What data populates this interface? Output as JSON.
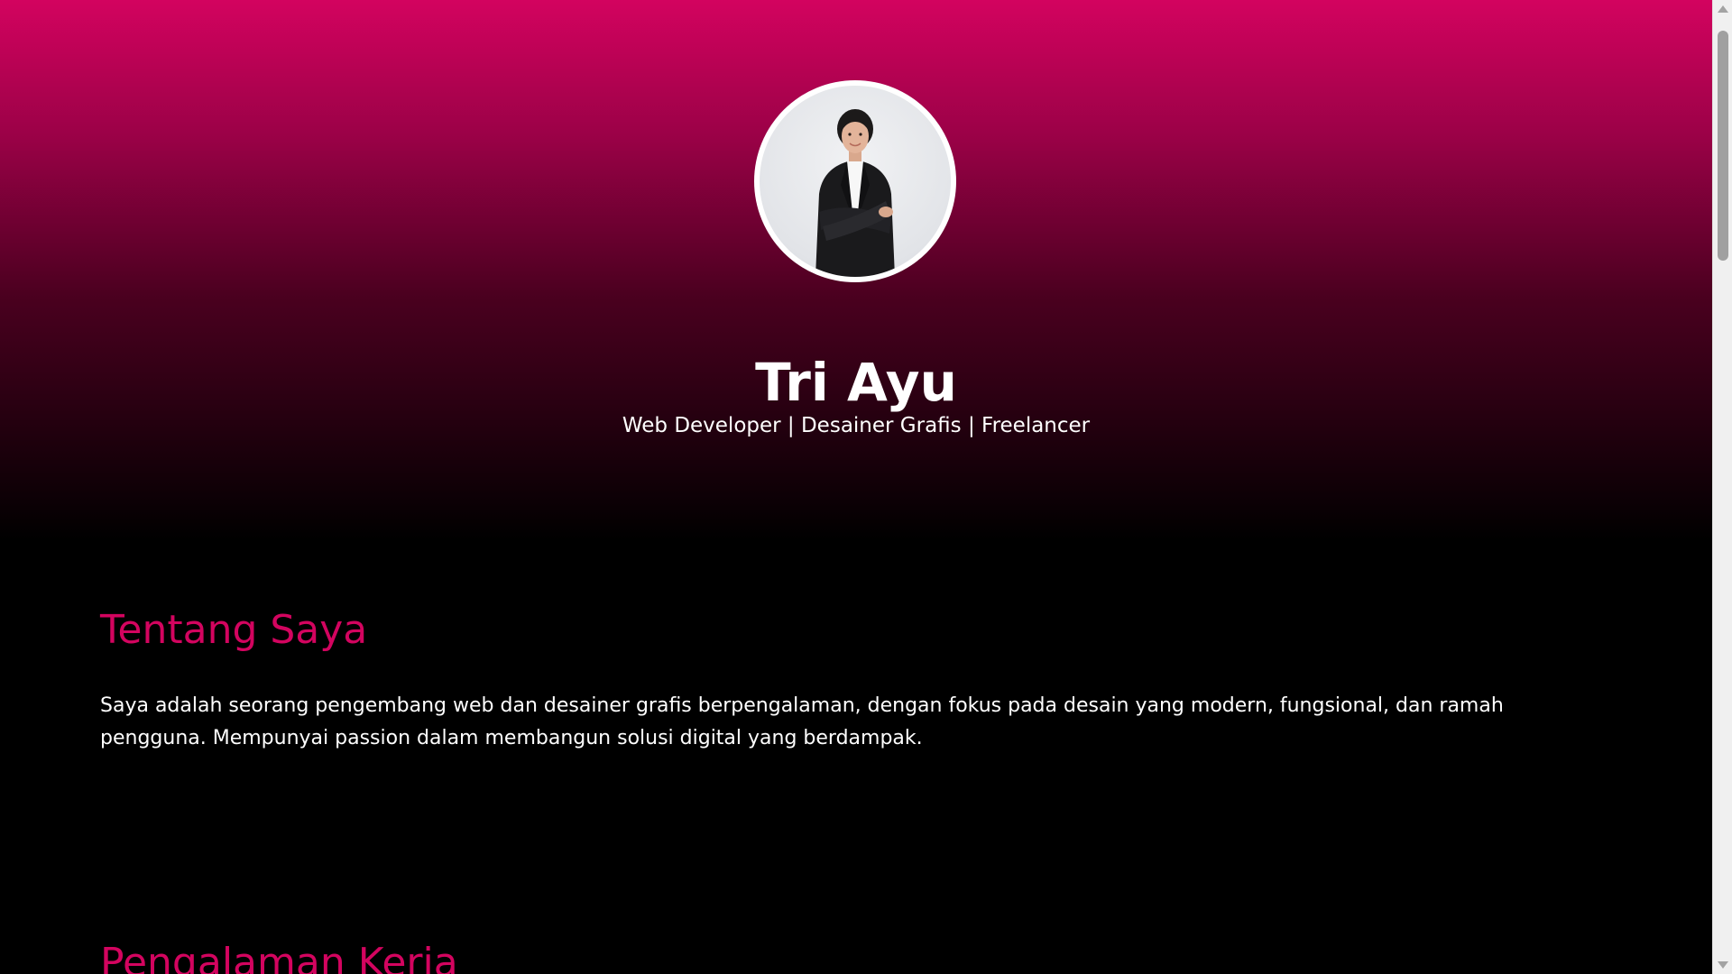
{
  "hero": {
    "name": "Tri Ayu",
    "tagline": "Web Developer | Desainer Grafis | Freelancer",
    "avatar_icon": "profile-photo",
    "gradient_top": "#d3035f",
    "gradient_bottom": "#000000"
  },
  "about": {
    "title": "Tentang Saya",
    "text": "Saya adalah seorang pengembang web dan desainer grafis berpengalaman, dengan fokus pada desain yang modern, fungsional, dan ramah pengguna. Mempunyai passion dalam membangun solusi digital yang berdampak."
  },
  "experience": {
    "title": "Pengalaman Kerja"
  },
  "theme": {
    "accent": "#d3045f",
    "background": "#000000",
    "text": "#ffffff"
  }
}
